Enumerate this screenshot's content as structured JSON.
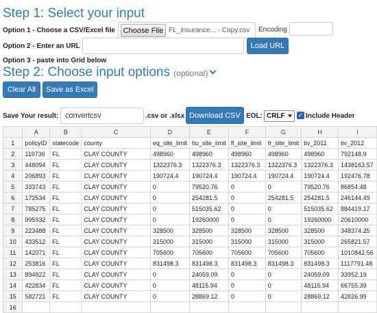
{
  "step1": {
    "title": "Step 1: Select your input",
    "option1_label": "Option 1 - Choose a CSV/Excel file",
    "choose_file_label": "Choose File",
    "file_name": "FL_insurance... - Copy.csv",
    "encoding_label": "Encoding",
    "encoding_value": "",
    "option2_label": "Option 2 - Enter an URL",
    "url_value": "",
    "load_url_label": "Load URL",
    "option3_label": "Option 3 - paste into Grid below"
  },
  "step2": {
    "title": "Step 2: Choose input options",
    "optional_label": "(optional)",
    "clear_all_label": "Clear All",
    "save_excel_label": "Save as Excel"
  },
  "save": {
    "label": "Save Your result:",
    "filename_value": "convertcsv",
    "ext_label": ".csv or .xlsx",
    "download_label": "Download CSV",
    "eol_label": "EOL:",
    "eol_value": "CRLF",
    "include_header_label": "Include Header",
    "include_header_checked": true
  },
  "grid": {
    "col_letters": [
      "A",
      "B",
      "C",
      "D",
      "E",
      "F",
      "G",
      "H",
      "I"
    ],
    "rows": [
      [
        "1",
        "policyID",
        "statecode",
        "county",
        "eq_site_limit",
        "hu_site_limit",
        "fl_site_limit",
        "fr_site_limit",
        "tiv_2011",
        "tiv_2012"
      ],
      [
        "2",
        "119736",
        "FL",
        "CLAY COUNTY",
        "498960",
        "498960",
        "498960",
        "498960",
        "498960",
        "792148.9"
      ],
      [
        "3",
        "448094",
        "FL",
        "CLAY COUNTY",
        "1322376.3",
        "1322376.3",
        "1322376.3",
        "1322376.3",
        "1322376.3",
        "1438163.57"
      ],
      [
        "4",
        "206893",
        "FL",
        "CLAY COUNTY",
        "190724.4",
        "190724.4",
        "190724.4",
        "190724.4",
        "190724.4",
        "192476.78"
      ],
      [
        "5",
        "333743",
        "FL",
        "CLAY COUNTY",
        "0",
        "79520.76",
        "0",
        "0",
        "79520.76",
        "86854.48"
      ],
      [
        "6",
        "172534",
        "FL",
        "CLAY COUNTY",
        "0",
        "254281.5",
        "0",
        "254281.5",
        "254281.5",
        "246144.49"
      ],
      [
        "7",
        "785275",
        "FL",
        "CLAY COUNTY",
        "0",
        "515035.62",
        "0",
        "0",
        "515035.62",
        "884419.17"
      ],
      [
        "8",
        "995932",
        "FL",
        "CLAY COUNTY",
        "0",
        "19260000",
        "0",
        "0",
        "19260000",
        "20610000"
      ],
      [
        "9",
        "223488",
        "FL",
        "CLAY COUNTY",
        "328500",
        "328500",
        "328500",
        "328500",
        "328500",
        "348374.25"
      ],
      [
        "10",
        "433512",
        "FL",
        "CLAY COUNTY",
        "315000",
        "315000",
        "315000",
        "315000",
        "315000",
        "265821.57"
      ],
      [
        "11",
        "142071",
        "FL",
        "CLAY COUNTY",
        "705600",
        "705600",
        "705600",
        "705600",
        "705600",
        "1010842.56"
      ],
      [
        "12",
        "253816",
        "FL",
        "CLAY COUNTY",
        "831498.3",
        "831498.3",
        "831498.3",
        "831498.3",
        "831498.3",
        "1117791.48"
      ],
      [
        "13",
        "894922",
        "FL",
        "CLAY COUNTY",
        "0",
        "24059.09",
        "0",
        "0",
        "24059.09",
        "33952.19"
      ],
      [
        "14",
        "422834",
        "FL",
        "CLAY COUNTY",
        "0",
        "48115.94",
        "0",
        "0",
        "48115.94",
        "66755.39"
      ],
      [
        "15",
        "582721",
        "FL",
        "CLAY COUNTY",
        "0",
        "28869.12",
        "0",
        "0",
        "28869.12",
        "42826.99"
      ],
      [
        "16",
        "",
        "",
        "",
        "",
        "",
        "",
        "",
        "",
        ""
      ]
    ]
  }
}
